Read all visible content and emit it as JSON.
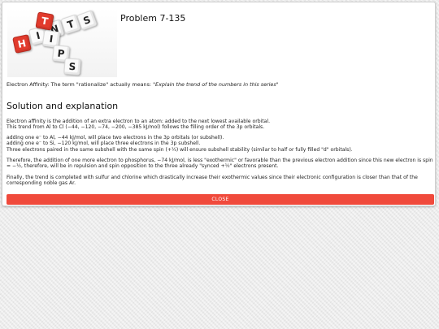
{
  "modal": {
    "title": "Problem 7-135",
    "image_letters": {
      "hints": [
        "H",
        "I",
        "N",
        "T",
        "S"
      ],
      "tips": [
        "T",
        "I",
        "P",
        "S"
      ]
    },
    "affinity_prefix": "Electron Affinity: The term \"rationalize\" actually means: ",
    "affinity_quote": "\"Explain the trend of the numbers in this series\"",
    "section_title": "Solution and explanation",
    "paragraphs": [
      "Electron affinity is the addition of an extra electron to an atom: added to the next lowest available orbital.",
      "This trend from Al to Cl (−44, −120, −74, −200, −385 kJ/mol) follows the filling order of the 3p orbitals.",
      "adding one e⁻ to Al, −44 kJ/mol, will place two electrons in the 3p orbitals (or subshell).",
      "adding one e⁻ to Si, −120 kJ/mol, will place three electrons in the 3p subshell.",
      "Three electrons paired in the same subshell with the same spin (+½) will ensure subshell stability (similar to half or fully filled \"d\" orbitals).",
      "Therefore, the addition of one more electron to phosphorus, −74 kJ/mol, is less \"exothermic\" or favorable than the previous electron addition since this new electron is spin = −½, therefore, will be in repulsion and spin opposition to the three already \"synced +½\" electrons present.",
      "Finally, the trend is completed with sulfur and chlorine which drastically increase their exothermic values since their electronic configuration is closer than that of the corresponding noble gas Ar."
    ],
    "close_label": "CLOSE"
  },
  "colors": {
    "close_button": "#f04a3c",
    "red_cube": "#e23b2d",
    "white_cube": "#fafafa"
  }
}
